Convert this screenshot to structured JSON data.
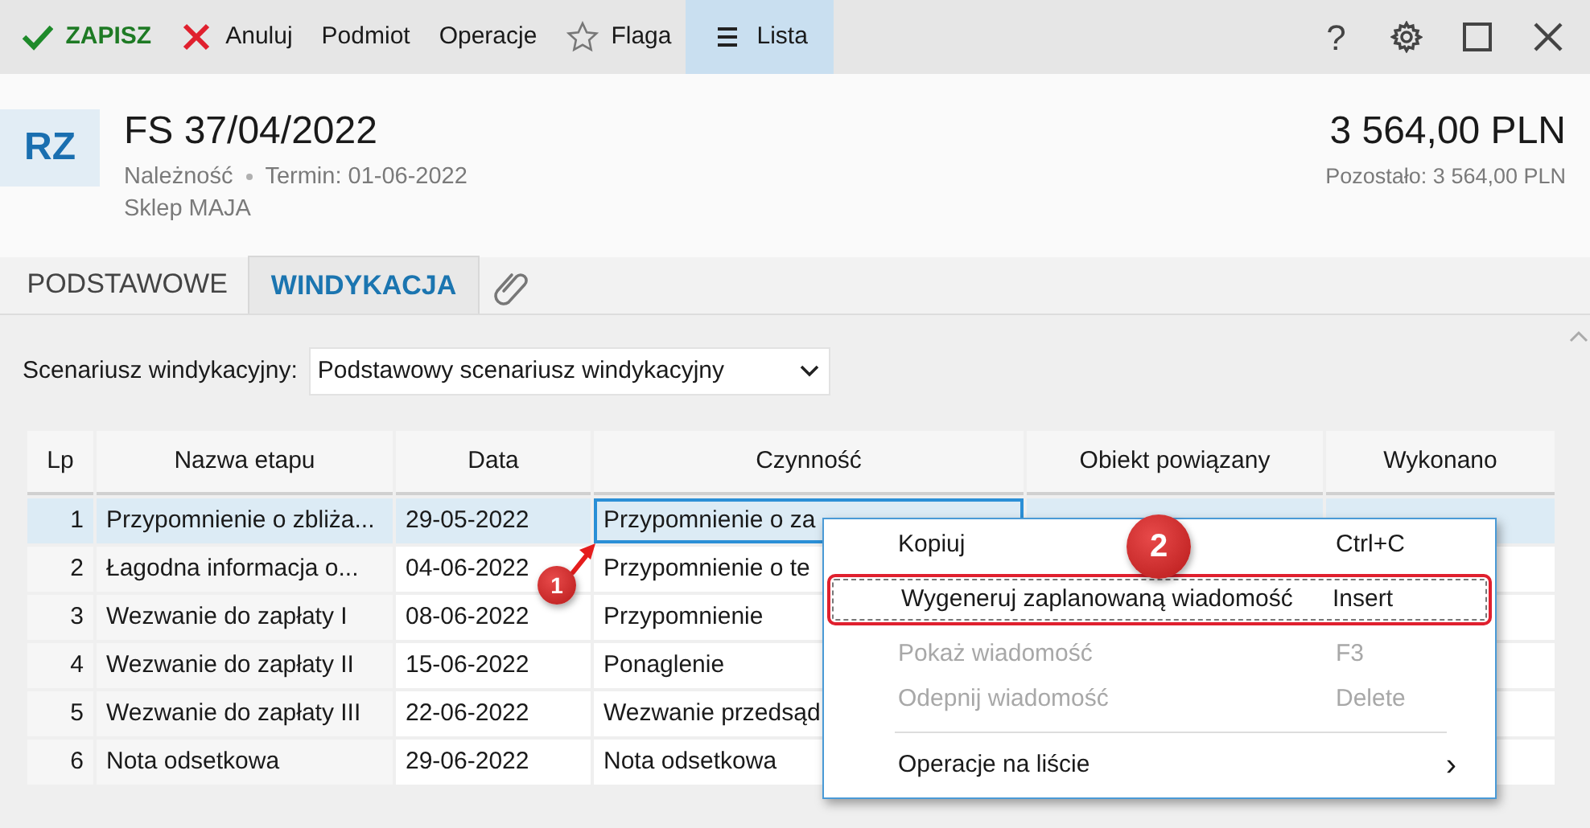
{
  "toolbar": {
    "items": [
      {
        "label": "ZAPISZ",
        "kind": "save",
        "selected": false
      },
      {
        "label": "Anuluj",
        "kind": "cancel",
        "selected": false
      },
      {
        "label": "Podmiot",
        "kind": "plain",
        "selected": false
      },
      {
        "label": "Operacje",
        "kind": "plain",
        "selected": false
      },
      {
        "label": "Flaga",
        "kind": "flag",
        "selected": false
      },
      {
        "label": "Lista",
        "kind": "list",
        "selected": true
      }
    ],
    "help_label": "?"
  },
  "header": {
    "badge": "RZ",
    "title": "FS 37/04/2022",
    "type": "Należność",
    "due": "Termin: 01-06-2022",
    "customer": "Sklep MAJA",
    "amount": "3 564,00 PLN",
    "remaining": "Pozostało: 3 564,00 PLN"
  },
  "tabs": [
    {
      "label": "PODSTAWOWE",
      "selected": false
    },
    {
      "label": "WINDYKACJA",
      "selected": true
    }
  ],
  "scenario": {
    "label": "Scenariusz windykacyjny:",
    "value": "Podstawowy scenariusz windykacyjny"
  },
  "table": {
    "columns": [
      "Lp",
      "Nazwa etapu",
      "Data",
      "Czynność",
      "Obiekt powiązany",
      "Wykonano"
    ],
    "rows": [
      {
        "selected": true,
        "cells": [
          "1",
          "Przypomnienie o zbliża...",
          "29-05-2022",
          "Przypomnienie o za"
        ]
      },
      {
        "selected": false,
        "cells": [
          "2",
          "Łagodna informacja o...",
          "04-06-2022",
          "Przypomnienie o te"
        ]
      },
      {
        "selected": false,
        "cells": [
          "3",
          "Wezwanie do zapłaty I",
          "08-06-2022",
          "Przypomnienie"
        ]
      },
      {
        "selected": false,
        "cells": [
          "4",
          "Wezwanie do zapłaty II",
          "15-06-2022",
          "Ponaglenie"
        ]
      },
      {
        "selected": false,
        "cells": [
          "5",
          "Wezwanie do zapłaty III",
          "22-06-2022",
          "Wezwanie przedsąd"
        ]
      },
      {
        "selected": false,
        "cells": [
          "6",
          "Nota odsetkowa",
          "29-06-2022",
          "Nota odsetkowa"
        ]
      }
    ]
  },
  "context_menu": {
    "items": [
      {
        "label": "Kopiuj",
        "shortcut": "Ctrl+C",
        "disabled": false,
        "selected": false,
        "kind": "item"
      },
      {
        "label": "Wygeneruj zaplanowaną wiadomość",
        "shortcut": "Insert",
        "disabled": false,
        "selected": true,
        "kind": "item"
      },
      {
        "label": "Pokaż wiadomość",
        "shortcut": "F3",
        "disabled": true,
        "selected": false,
        "kind": "item"
      },
      {
        "label": "Odepnij wiadomość",
        "shortcut": "Delete",
        "disabled": true,
        "selected": false,
        "kind": "item"
      },
      {
        "label": "Operacje na liście",
        "shortcut": "›",
        "disabled": false,
        "selected": false,
        "kind": "submenu"
      }
    ]
  },
  "annotations": [
    {
      "label": "1"
    },
    {
      "label": "2"
    }
  ]
}
